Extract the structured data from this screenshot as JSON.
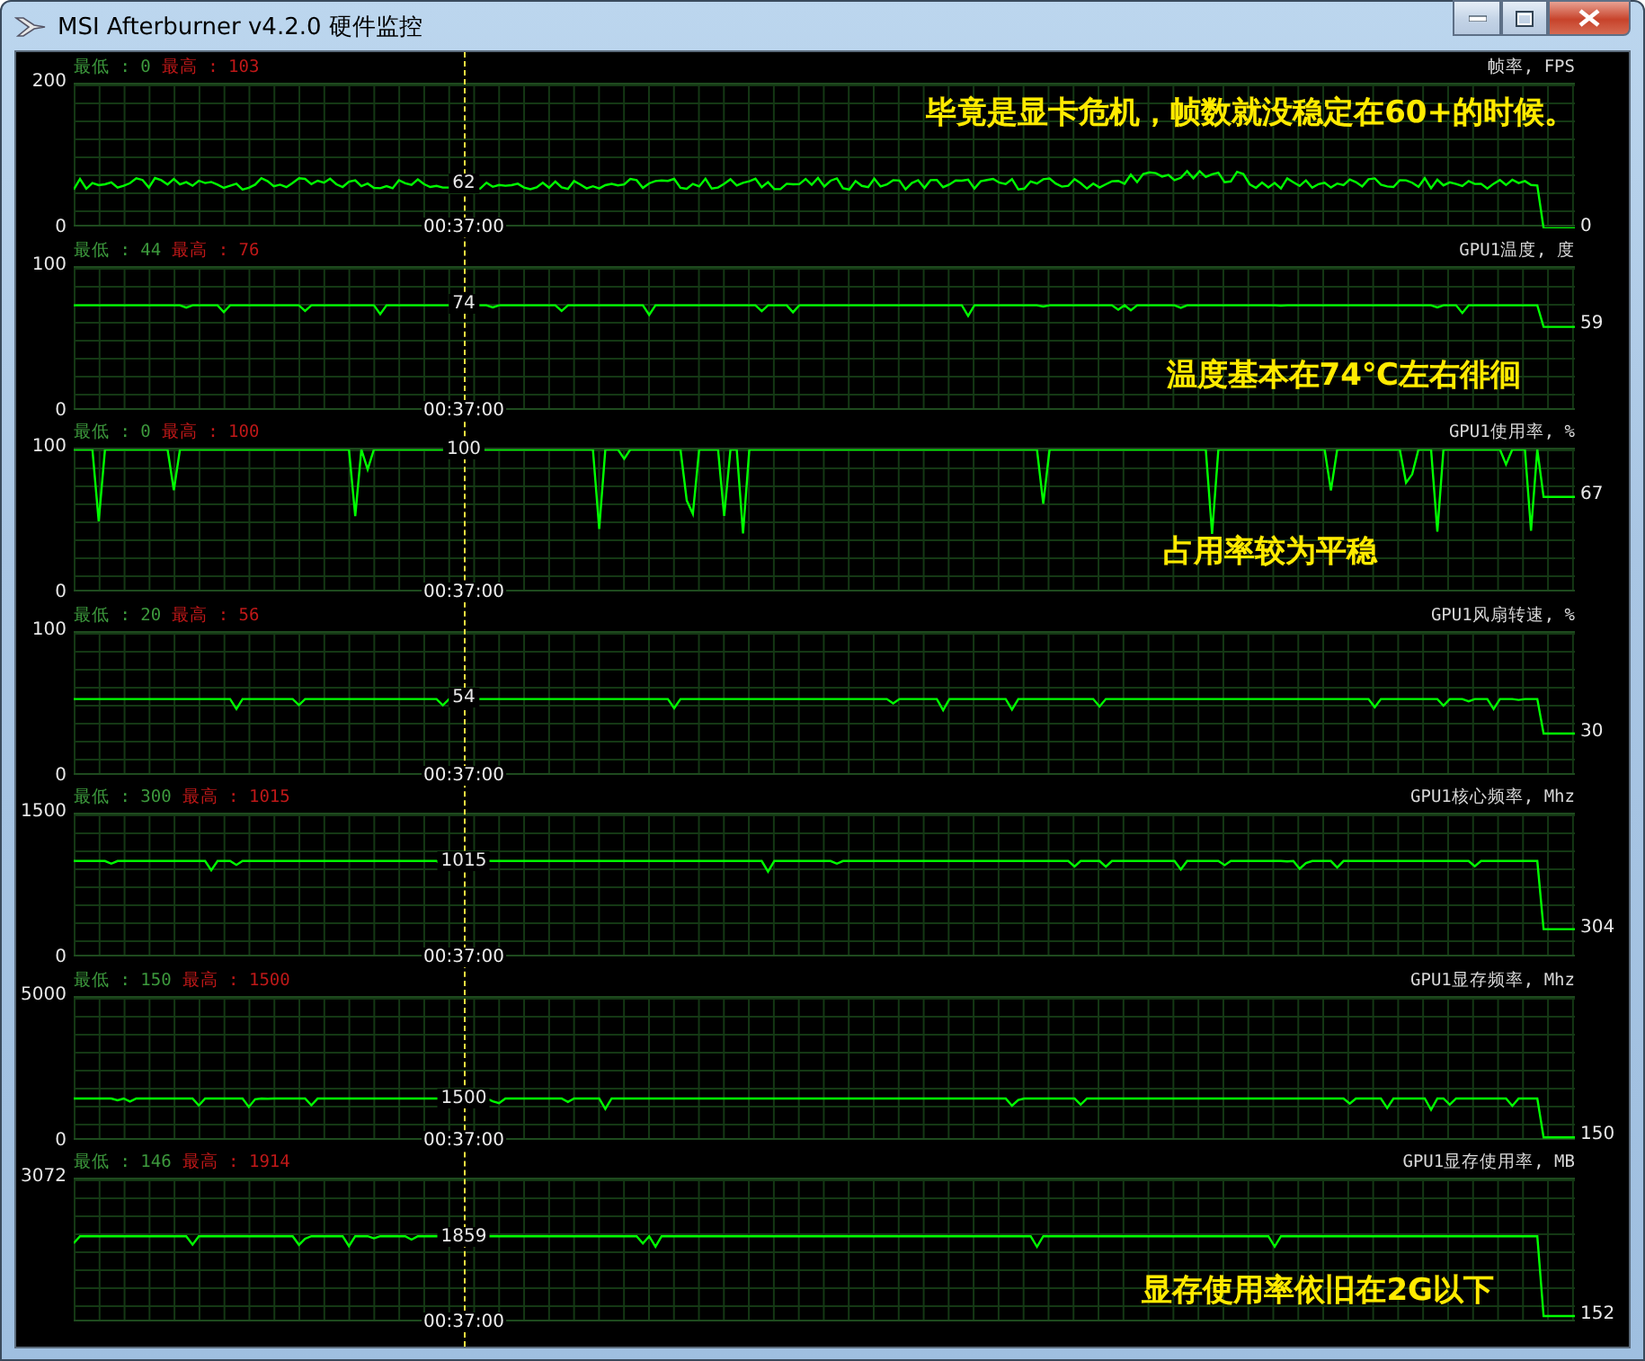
{
  "window": {
    "title": "MSI Afterburner v4.2.0 硬件监控"
  },
  "panels": [
    {
      "min": "最低 : 0",
      "max": "最高 : 103",
      "name": "帧率, FPS",
      "ymax": "200",
      "ymin": "0",
      "cursor_value": "62",
      "current": "0",
      "time": "00:37:00",
      "annotation": "毕竟是显卡危机，帧数就没稳定在60+的时候。"
    },
    {
      "min": "最低 : 44",
      "max": "最高 : 76",
      "name": "GPU1温度, 度",
      "ymax": "100",
      "ymin": "0",
      "cursor_value": "74",
      "current": "59",
      "time": "00:37:00",
      "annotation": "温度基本在74℃左右徘徊"
    },
    {
      "min": "最低 : 0",
      "max": "最高 : 100",
      "name": "GPU1使用率, %",
      "ymax": "100",
      "ymin": "0",
      "cursor_value": "100",
      "current": "67",
      "time": "00:37:00",
      "annotation": "占用率较为平稳"
    },
    {
      "min": "最低 : 20",
      "max": "最高 : 56",
      "name": "GPU1风扇转速, %",
      "ymax": "100",
      "ymin": "0",
      "cursor_value": "54",
      "current": "30",
      "time": "00:37:00"
    },
    {
      "min": "最低 : 300",
      "max": "最高 : 1015",
      "name": "GPU1核心频率, Mhz",
      "ymax": "1500",
      "ymin": "0",
      "cursor_value": "1015",
      "current": "304",
      "time": "00:37:00"
    },
    {
      "min": "最低 : 150",
      "max": "最高 : 1500",
      "name": "GPU1显存频率, Mhz",
      "ymax": "5000",
      "ymin": "0",
      "cursor_value": "1500",
      "current": "150",
      "time": "00:37:00"
    },
    {
      "min": "最低 : 146",
      "max": "最高 : 1914",
      "name": "GPU1显存使用率, MB",
      "ymax": "3072",
      "cursor_value": "1859",
      "current": "152",
      "time": "00:37:00",
      "annotation": "显存使用率依旧在2G以下"
    }
  ]
}
